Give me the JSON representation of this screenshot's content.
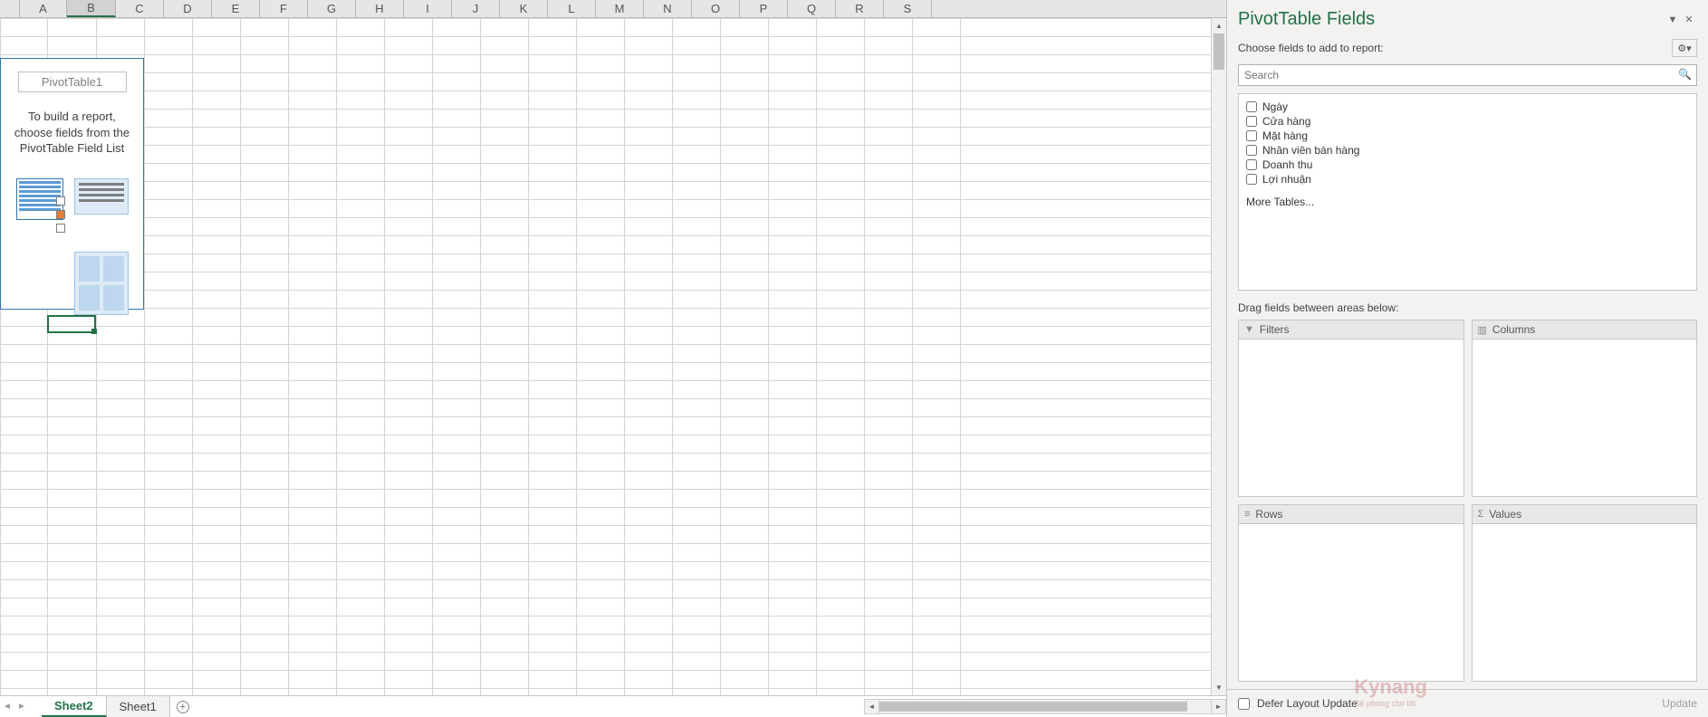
{
  "columns": [
    "A",
    "B",
    "C",
    "D",
    "E",
    "F",
    "G",
    "H",
    "I",
    "J",
    "K",
    "L",
    "M",
    "N",
    "O",
    "P",
    "Q",
    "R",
    "S"
  ],
  "selected_column_index": 1,
  "pivot_placeholder": {
    "name": "PivotTable1",
    "message": "To build a report, choose fields from the PivotTable Field List"
  },
  "sheets": {
    "active": "Sheet2",
    "other": "Sheet1"
  },
  "pane": {
    "title": "PivotTable Fields",
    "subtitle": "Choose fields to add to report:",
    "search_placeholder": "Search",
    "fields": [
      "Ngày",
      "Cửa hàng",
      "Mặt hàng",
      "Nhân viên bán hàng",
      "Doanh thu",
      "Lợi nhuận"
    ],
    "more_tables": "More Tables...",
    "drag_label": "Drag fields between areas below:",
    "areas": {
      "filters": "Filters",
      "columns": "Columns",
      "rows": "Rows",
      "values": "Values"
    },
    "defer_label": "Defer Layout Update",
    "update_label": "Update"
  },
  "watermark": {
    "brand": "Kynang",
    "tag": "Bệ phóng cho tôi"
  }
}
